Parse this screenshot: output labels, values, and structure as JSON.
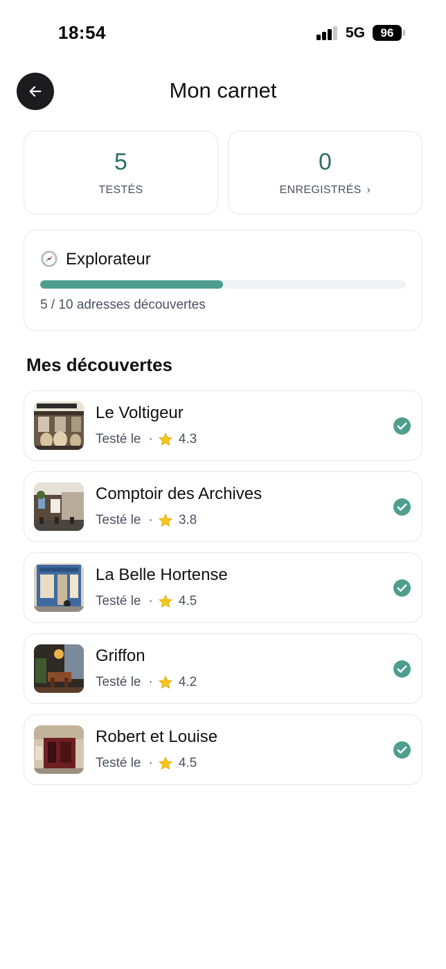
{
  "status_bar": {
    "time": "18:54",
    "network": "5G",
    "battery": "96",
    "signal_bars": 3
  },
  "header": {
    "title": "Mon carnet",
    "back_icon": "arrow-left-icon"
  },
  "stats": {
    "tested": {
      "value": "5",
      "label": "TESTÉS"
    },
    "saved": {
      "value": "0",
      "label": "ENREGISTRÉS",
      "chevron": "›"
    }
  },
  "explorer": {
    "icon": "compass-icon",
    "title": "Explorateur",
    "progress_label": "5 / 10 adresses découvertes",
    "progress_fraction": 0.5
  },
  "section_title": "Mes découvertes",
  "places": [
    {
      "name": "Le Voltigeur",
      "tested_label": "Testé le",
      "separator": "·",
      "rating": "4.3",
      "thumb": "cafe-terrace-teddy-bears"
    },
    {
      "name": "Comptoir des Archives",
      "tested_label": "Testé le",
      "separator": "·",
      "rating": "3.8",
      "thumb": "corner-cafe-terrace"
    },
    {
      "name": "La Belle Hortense",
      "tested_label": "Testé le",
      "separator": "·",
      "rating": "4.5",
      "thumb": "blue-storefront"
    },
    {
      "name": "Griffon",
      "tested_label": "Testé le",
      "separator": "·",
      "rating": "4.2",
      "thumb": "dark-bar-interior"
    },
    {
      "name": "Robert et Louise",
      "tested_label": "Testé le",
      "separator": "·",
      "rating": "4.5",
      "thumb": "red-facade-restaurant"
    }
  ],
  "colors": {
    "accent": "#2f6e64",
    "progress": "#4e9e8e",
    "check": "#4e9e8e",
    "muted_text": "#4a5161",
    "border": "#e6e6e9"
  }
}
